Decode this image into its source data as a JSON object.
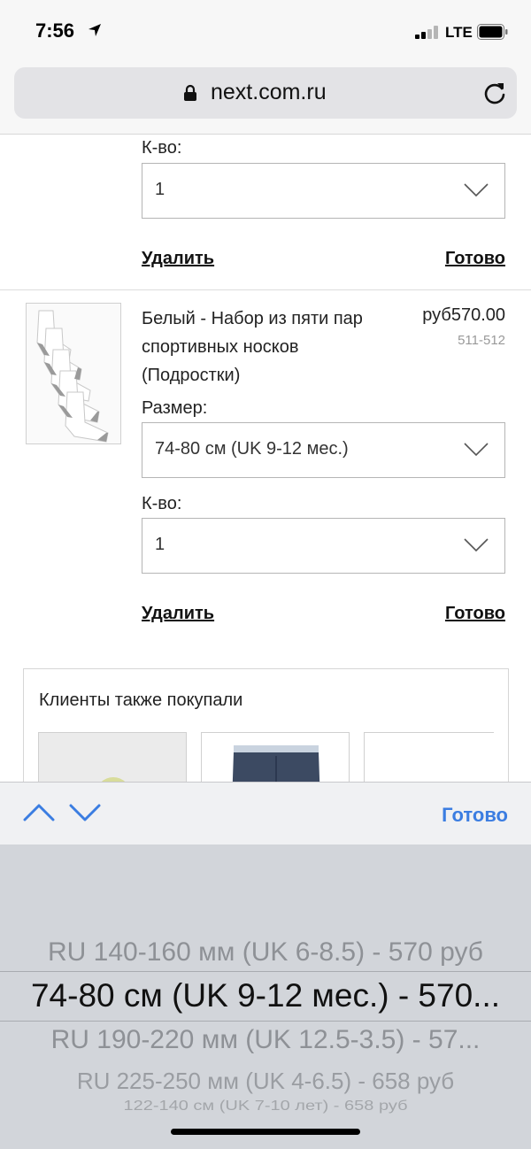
{
  "status_bar": {
    "time": "7:56",
    "network": "LTE"
  },
  "browser": {
    "url": "next.com.ru"
  },
  "item1": {
    "qty_label": "К-во:",
    "qty_value": "1",
    "remove_label": "Удалить",
    "done_label": "Готово"
  },
  "item2": {
    "title": "Белый - Набор из пяти пар спортивных носков (Подростки)",
    "price": "руб570.00",
    "code": "511-512",
    "size_label": "Размер:",
    "size_value": "74-80 см (UK 9-12 мес.)",
    "qty_label": "К-во:",
    "qty_value": "1",
    "remove_label": "Удалить",
    "done_label": "Готово"
  },
  "recommendations": {
    "title": "Клиенты также покупали"
  },
  "keyboard_accessory": {
    "done_label": "Готово"
  },
  "picker": {
    "options": [
      "RU 140-160 мм (UK 6-8.5) - 570 руб",
      "74-80 см (UK 9-12 мес.) - 570...",
      "RU 190-220 мм (UK 12.5-3.5) - 57...",
      "RU 225-250 мм (UK 4-6.5) - 658 руб",
      "122-140 см (UK 7-10 лет) - 658 руб"
    ]
  },
  "colors": {
    "accent": "#3b7de1",
    "picker_bg": "#d2d5da"
  }
}
